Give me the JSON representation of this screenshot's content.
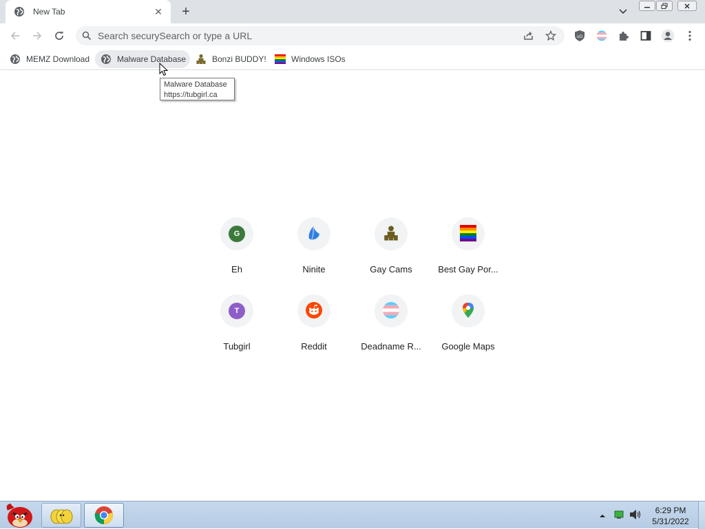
{
  "tab": {
    "title": "New Tab",
    "close": "✕"
  },
  "newtab": "+",
  "omnibox": {
    "placeholder": "Search securySearch or type a URL"
  },
  "bookmarks": [
    {
      "label": "MEMZ Download",
      "icon": "globe-icon"
    },
    {
      "label": "Malware Database",
      "icon": "globe-icon"
    },
    {
      "label": "Bonzi BUDDY!",
      "icon": "bonzi-icon"
    },
    {
      "label": "Windows ISOs",
      "icon": "rainbow-flag-icon"
    }
  ],
  "tooltip": {
    "title": "Malware Database",
    "url": "https://tubgirl.ca"
  },
  "shortcuts": [
    {
      "label": "Eh",
      "icon": "letter-g-icon",
      "letter": "G",
      "color": "#3c7a3c"
    },
    {
      "label": "Ninite",
      "icon": "ninite-icon"
    },
    {
      "label": "Gay Cams",
      "icon": "bonzi-icon"
    },
    {
      "label": "Best Gay Por...",
      "icon": "rainbow-flag-icon"
    },
    {
      "label": "Tubgirl",
      "icon": "letter-t-icon",
      "letter": "T",
      "color": "#8e5ec8"
    },
    {
      "label": "Reddit",
      "icon": "reddit-icon"
    },
    {
      "label": "Deadname R...",
      "icon": "trans-flag-icon"
    },
    {
      "label": "Google Maps",
      "icon": "maps-pin-icon"
    }
  ],
  "taskbar": {
    "clock_time": "6:29 PM",
    "clock_date": "5/31/2022"
  },
  "colors": {
    "tabstrip": "#dee1e6",
    "omnibox": "#f1f3f4",
    "taskbar": "#c5d8ec"
  }
}
